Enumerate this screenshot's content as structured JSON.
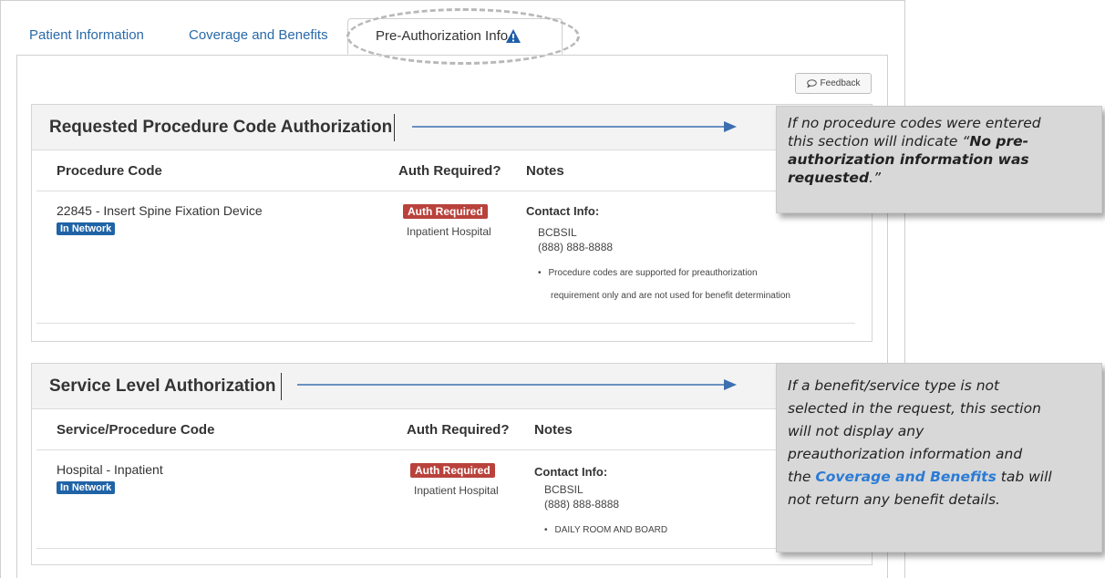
{
  "tabs": {
    "patient": "Patient Information",
    "coverage": "Coverage and Benefits",
    "preauth": "Pre-Authorization Info"
  },
  "feedback": {
    "label": "Feedback"
  },
  "procedure_section": {
    "title": "Requested Procedure Code Authorization",
    "col_code": "Procedure Code",
    "col_auth": "Auth Required?",
    "col_notes": "Notes",
    "row": {
      "code": "22845 - Insert Spine Fixation Device",
      "network": "In Network",
      "auth_badge": "Auth Required",
      "auth_setting": "Inpatient Hospital",
      "contact_label": "Contact Info:",
      "contact_name": "BCBSIL",
      "contact_phone": "(888) 888-8888",
      "note_line1": "Procedure codes are supported for preauthorization",
      "note_line2": "requirement only and are not used for benefit determination"
    }
  },
  "service_section": {
    "title": "Service Level Authorization",
    "col_code": "Service/Procedure Code",
    "col_auth": "Auth Required?",
    "col_notes": "Notes",
    "row": {
      "code": "Hospital - Inpatient",
      "network": "In Network",
      "auth_badge": "Auth Required",
      "auth_setting": "Inpatient Hospital",
      "contact_label": "Contact Info:",
      "contact_name": "BCBSIL",
      "contact_phone": "(888) 888-8888",
      "note": "DAILY ROOM AND BOARD"
    }
  },
  "callout1": {
    "line1": "If no procedure codes were entered",
    "line2a": "this section will indicate “",
    "line2b": "No pre-",
    "line3": "authorization information was",
    "line4a": "requested",
    "line4b": ".”"
  },
  "callout2": {
    "line1": "If a benefit/service type is not",
    "line2": "selected in the request, this section",
    "line3": "will not display any",
    "line4": "preauthorization information and",
    "line5a": "the ",
    "line5b": "Coverage and Benefits",
    "line5c": " tab will",
    "line6": "not return any benefit details."
  },
  "colors": {
    "link": "#2a6aa9",
    "network_badge": "#2063a6",
    "auth_badge": "#b9423c",
    "callout_bg": "#d8d8d8",
    "arrow": "#3c6fb0"
  },
  "icons": {
    "warning": "warning-triangle-icon",
    "feedback": "speech-bubble-icon"
  }
}
